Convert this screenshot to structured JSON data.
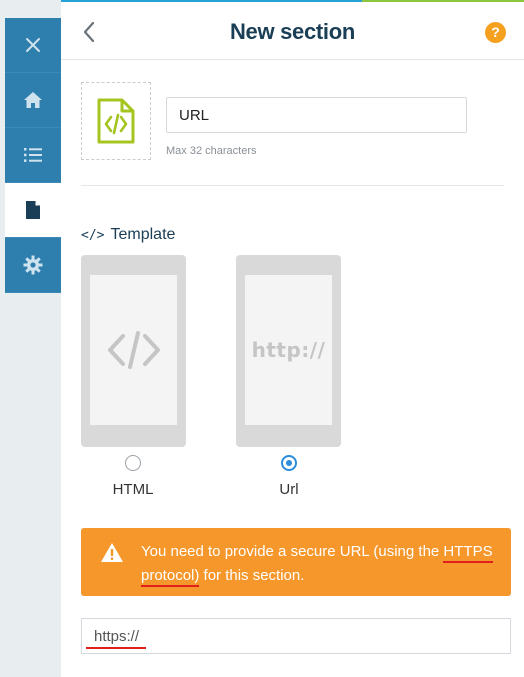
{
  "sidebar": {
    "items": [
      {
        "icon": "close-icon",
        "active": false
      },
      {
        "icon": "home-icon",
        "active": false
      },
      {
        "icon": "list-icon",
        "active": false
      },
      {
        "icon": "document-icon",
        "active": true
      },
      {
        "icon": "gear-icon",
        "active": false
      }
    ]
  },
  "header": {
    "title": "New section",
    "help_label": "?"
  },
  "section_name": {
    "value": "URL",
    "hint": "Max 32 characters"
  },
  "template": {
    "heading": "Template",
    "options": [
      {
        "label": "HTML",
        "selected": false
      },
      {
        "label": "Url",
        "selected": true,
        "preview_text": "http://"
      }
    ]
  },
  "alert": {
    "text_before": "You need to provide a secure URL (using the ",
    "text_link": "HTTPS protocol)",
    "text_after": " for this section."
  },
  "url_field": {
    "value": "https://"
  },
  "colors": {
    "accent_blue": "#2e7fae",
    "title_navy": "#1a3e55",
    "alert_orange": "#f6972c",
    "help_orange": "#f6a020",
    "icon_lime": "#a4c520"
  }
}
